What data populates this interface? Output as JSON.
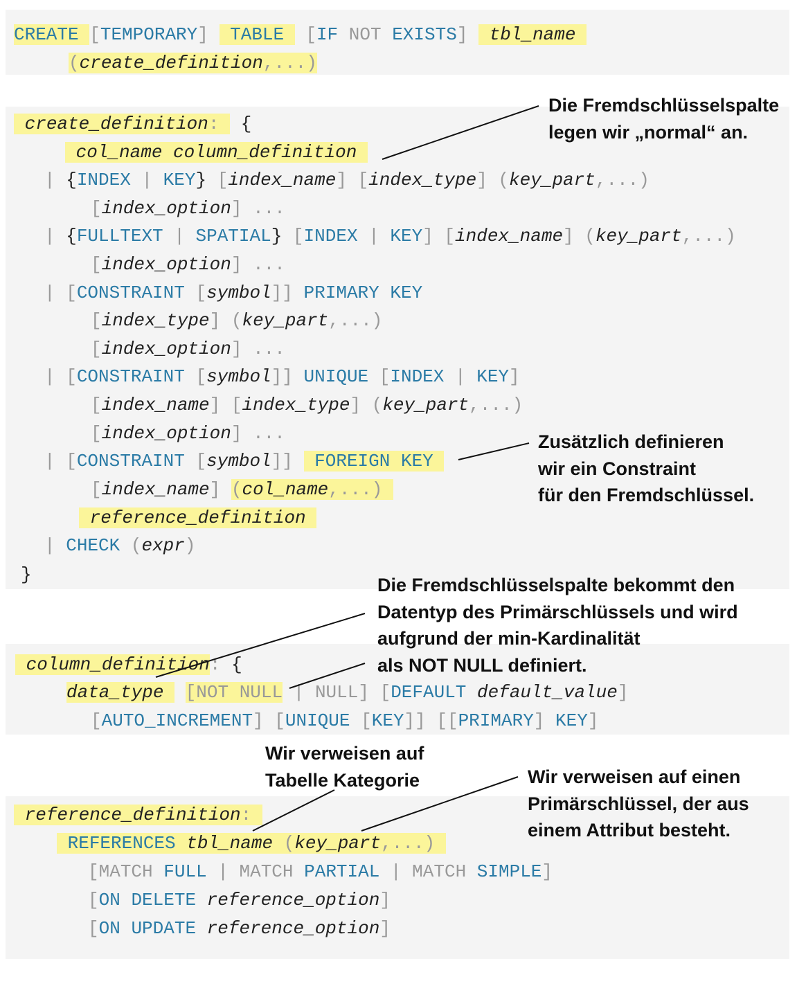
{
  "code": {
    "t": {
      "create": "CREATE",
      "temporary": "TEMPORARY",
      "table": "TABLE",
      "if": "IF",
      "not": "NOT",
      "exists": "EXISTS",
      "tbl_name": "tbl_name",
      "create_definition": "create_definition",
      "ellipsis": "...",
      "colon": ":",
      "col_name": "col_name",
      "column_definition": "column_definition",
      "index": "INDEX",
      "key": "KEY",
      "index_name": "index_name",
      "index_type": "index_type",
      "key_part": "key_part",
      "index_option": "index_option",
      "fulltext": "FULLTEXT",
      "spatial": "SPATIAL",
      "constraint": "CONSTRAINT",
      "symbol": "symbol",
      "primary": "PRIMARY",
      "unique": "UNIQUE",
      "foreign": "FOREIGN",
      "reference_definition": "reference_definition",
      "check": "CHECK",
      "expr": "expr",
      "data_type": "data_type",
      "null": "NULL",
      "default": "DEFAULT",
      "default_value": "default_value",
      "auto_increment": "AUTO_INCREMENT",
      "references": "REFERENCES",
      "match": "MATCH",
      "full": "FULL",
      "partial": "PARTIAL",
      "simple": "SIMPLE",
      "on": "ON",
      "delete": "DELETE",
      "update": "UPDATE",
      "reference_option": "reference_option"
    }
  },
  "annotations": {
    "fk_column": "Die Fremdschlüsselspalte\nlegen wir „normal“ an.",
    "constraint": "Zusätzlich definieren\nwir ein Constraint\nfür den Fremdschlüssel.",
    "datatype": "Die Fremdschlüsselspalte bekommt den\nDatentyp des Primärschlüssels und wird\naufgrund der min-Kardinalität\nals NOT NULL definiert.",
    "table_ref": "Wir verweisen auf\nTabelle Kategorie",
    "pk_ref": "Wir verweisen auf einen\nPrimärschlüssel, der aus\neinem Attribut besteht."
  },
  "colors": {
    "keyword": "#2b7ba6",
    "highlight": "#fbf59a",
    "block_bg": "#f4f4f4"
  }
}
